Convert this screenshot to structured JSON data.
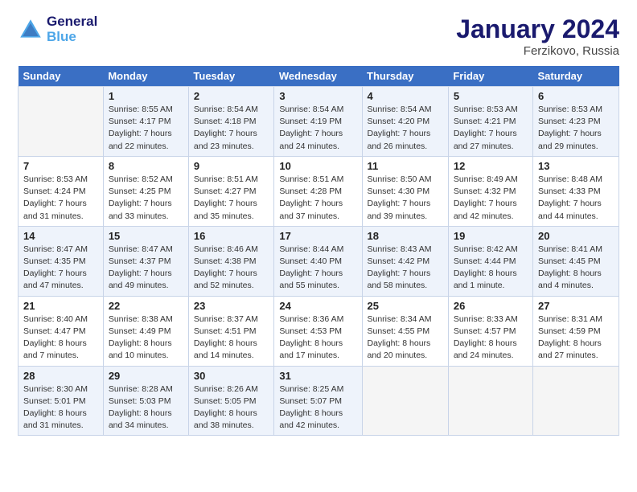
{
  "logo": {
    "line1": "General",
    "line2": "Blue"
  },
  "title": "January 2024",
  "subtitle": "Ferzikovo, Russia",
  "days_header": [
    "Sunday",
    "Monday",
    "Tuesday",
    "Wednesday",
    "Thursday",
    "Friday",
    "Saturday"
  ],
  "weeks": [
    [
      {
        "num": "",
        "info": ""
      },
      {
        "num": "1",
        "info": "Sunrise: 8:55 AM\nSunset: 4:17 PM\nDaylight: 7 hours\nand 22 minutes."
      },
      {
        "num": "2",
        "info": "Sunrise: 8:54 AM\nSunset: 4:18 PM\nDaylight: 7 hours\nand 23 minutes."
      },
      {
        "num": "3",
        "info": "Sunrise: 8:54 AM\nSunset: 4:19 PM\nDaylight: 7 hours\nand 24 minutes."
      },
      {
        "num": "4",
        "info": "Sunrise: 8:54 AM\nSunset: 4:20 PM\nDaylight: 7 hours\nand 26 minutes."
      },
      {
        "num": "5",
        "info": "Sunrise: 8:53 AM\nSunset: 4:21 PM\nDaylight: 7 hours\nand 27 minutes."
      },
      {
        "num": "6",
        "info": "Sunrise: 8:53 AM\nSunset: 4:23 PM\nDaylight: 7 hours\nand 29 minutes."
      }
    ],
    [
      {
        "num": "7",
        "info": "Sunrise: 8:53 AM\nSunset: 4:24 PM\nDaylight: 7 hours\nand 31 minutes."
      },
      {
        "num": "8",
        "info": "Sunrise: 8:52 AM\nSunset: 4:25 PM\nDaylight: 7 hours\nand 33 minutes."
      },
      {
        "num": "9",
        "info": "Sunrise: 8:51 AM\nSunset: 4:27 PM\nDaylight: 7 hours\nand 35 minutes."
      },
      {
        "num": "10",
        "info": "Sunrise: 8:51 AM\nSunset: 4:28 PM\nDaylight: 7 hours\nand 37 minutes."
      },
      {
        "num": "11",
        "info": "Sunrise: 8:50 AM\nSunset: 4:30 PM\nDaylight: 7 hours\nand 39 minutes."
      },
      {
        "num": "12",
        "info": "Sunrise: 8:49 AM\nSunset: 4:32 PM\nDaylight: 7 hours\nand 42 minutes."
      },
      {
        "num": "13",
        "info": "Sunrise: 8:48 AM\nSunset: 4:33 PM\nDaylight: 7 hours\nand 44 minutes."
      }
    ],
    [
      {
        "num": "14",
        "info": "Sunrise: 8:47 AM\nSunset: 4:35 PM\nDaylight: 7 hours\nand 47 minutes."
      },
      {
        "num": "15",
        "info": "Sunrise: 8:47 AM\nSunset: 4:37 PM\nDaylight: 7 hours\nand 49 minutes."
      },
      {
        "num": "16",
        "info": "Sunrise: 8:46 AM\nSunset: 4:38 PM\nDaylight: 7 hours\nand 52 minutes."
      },
      {
        "num": "17",
        "info": "Sunrise: 8:44 AM\nSunset: 4:40 PM\nDaylight: 7 hours\nand 55 minutes."
      },
      {
        "num": "18",
        "info": "Sunrise: 8:43 AM\nSunset: 4:42 PM\nDaylight: 7 hours\nand 58 minutes."
      },
      {
        "num": "19",
        "info": "Sunrise: 8:42 AM\nSunset: 4:44 PM\nDaylight: 8 hours\nand 1 minute."
      },
      {
        "num": "20",
        "info": "Sunrise: 8:41 AM\nSunset: 4:45 PM\nDaylight: 8 hours\nand 4 minutes."
      }
    ],
    [
      {
        "num": "21",
        "info": "Sunrise: 8:40 AM\nSunset: 4:47 PM\nDaylight: 8 hours\nand 7 minutes."
      },
      {
        "num": "22",
        "info": "Sunrise: 8:38 AM\nSunset: 4:49 PM\nDaylight: 8 hours\nand 10 minutes."
      },
      {
        "num": "23",
        "info": "Sunrise: 8:37 AM\nSunset: 4:51 PM\nDaylight: 8 hours\nand 14 minutes."
      },
      {
        "num": "24",
        "info": "Sunrise: 8:36 AM\nSunset: 4:53 PM\nDaylight: 8 hours\nand 17 minutes."
      },
      {
        "num": "25",
        "info": "Sunrise: 8:34 AM\nSunset: 4:55 PM\nDaylight: 8 hours\nand 20 minutes."
      },
      {
        "num": "26",
        "info": "Sunrise: 8:33 AM\nSunset: 4:57 PM\nDaylight: 8 hours\nand 24 minutes."
      },
      {
        "num": "27",
        "info": "Sunrise: 8:31 AM\nSunset: 4:59 PM\nDaylight: 8 hours\nand 27 minutes."
      }
    ],
    [
      {
        "num": "28",
        "info": "Sunrise: 8:30 AM\nSunset: 5:01 PM\nDaylight: 8 hours\nand 31 minutes."
      },
      {
        "num": "29",
        "info": "Sunrise: 8:28 AM\nSunset: 5:03 PM\nDaylight: 8 hours\nand 34 minutes."
      },
      {
        "num": "30",
        "info": "Sunrise: 8:26 AM\nSunset: 5:05 PM\nDaylight: 8 hours\nand 38 minutes."
      },
      {
        "num": "31",
        "info": "Sunrise: 8:25 AM\nSunset: 5:07 PM\nDaylight: 8 hours\nand 42 minutes."
      },
      {
        "num": "",
        "info": ""
      },
      {
        "num": "",
        "info": ""
      },
      {
        "num": "",
        "info": ""
      }
    ]
  ]
}
